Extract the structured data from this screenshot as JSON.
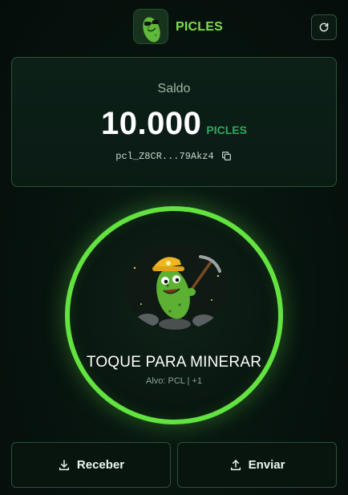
{
  "header": {
    "brand": "PICLES",
    "logo_icon": "pickle-sunglasses-logo",
    "refresh_icon": "refresh-icon"
  },
  "balance": {
    "label": "Saldo",
    "amount": "10.000",
    "unit": "PICLES",
    "address": "pcl_Z8CR...79Akz4",
    "copy_icon": "copy-icon"
  },
  "mine": {
    "title": "TOQUE PARA MINERAR",
    "subtitle": "Alvo: PCL | +1",
    "mascot_icon": "pickle-miner-mascot"
  },
  "actions": {
    "receive_label": "Receber",
    "receive_icon": "download-icon",
    "send_label": "Enviar",
    "send_icon": "upload-icon"
  },
  "colors": {
    "accent": "#62e33f",
    "brand": "#7ee04a",
    "unit": "#2faa5c",
    "background": "#07130e"
  }
}
